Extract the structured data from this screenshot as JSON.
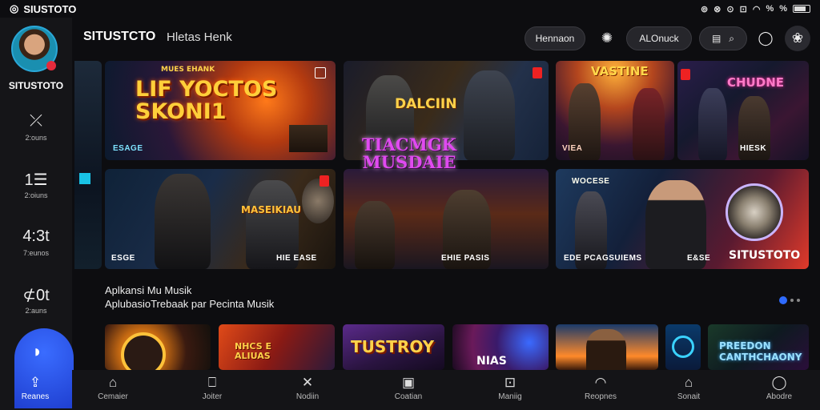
{
  "status": {
    "brand": "SIUSTOTO",
    "icons": [
      "⊚",
      "⊗",
      "⊙",
      "⊡",
      "⊠"
    ],
    "signal": "%",
    "percent": "%"
  },
  "sidebar": {
    "username": "SITUSTOTO",
    "items": [
      {
        "icon": "⤫",
        "label": "2:ouns"
      },
      {
        "icon": "1☰",
        "label": "2:oiuns"
      },
      {
        "icon": "4:3t",
        "label": "7:eunos"
      },
      {
        "icon": "⊄0t",
        "label": "2:auns"
      }
    ]
  },
  "header": {
    "title": "SITUSTCTO",
    "subtitle": "Hletas Henk",
    "pill_left": "Hennaon",
    "pill_right": "ALOnuck"
  },
  "banners": [
    {
      "title": "LIF YOCTOS SKONI1",
      "tag": "MUES EHANK",
      "caption": "ESAGE"
    },
    {
      "title": "DALCIIN",
      "caption": ""
    },
    {
      "title": "VASTINE",
      "caption": "VIEA"
    },
    {
      "title": "CHUDNE",
      "caption": "HIESK"
    },
    {
      "title": "MASEIKIAU",
      "caption": "ESGE",
      "caption2": "HIE EASE"
    },
    {
      "title": "TIACMGK MUSDAIE",
      "caption": "EHIE PASIS"
    },
    {
      "title": "SITUSTOTO",
      "tag": "WOCESE",
      "caption": "EDE PCAGSUIEMS",
      "caption2": "E&SE"
    }
  ],
  "section": {
    "line1": "Aplkansi Mu Musik",
    "line2": "AplubasioTrebaak par Pecinta Musik"
  },
  "thumbs": [
    {
      "title": ""
    },
    {
      "title": "NHCS E ALIUAS"
    },
    {
      "title": "TUSTROY"
    },
    {
      "title": "NIAS"
    },
    {
      "title": ""
    },
    {
      "title": ""
    },
    {
      "title": "PREEDON CANTHCHAONY"
    }
  ],
  "bottom_nav": {
    "active": {
      "label": "Reanes"
    },
    "items": [
      {
        "icon": "⌂",
        "label": "Cemaier"
      },
      {
        "icon": "⎕",
        "label": "Joiter"
      },
      {
        "icon": "✕",
        "label": "Nodiin"
      },
      {
        "icon": "▣",
        "label": "Coatian"
      },
      {
        "icon": "⊡",
        "label": "Maniig"
      },
      {
        "icon": "◠",
        "label": "Reopnes"
      },
      {
        "icon": "⌂",
        "label": "Sonait"
      },
      {
        "icon": "◯",
        "label": "Abodre"
      }
    ]
  }
}
